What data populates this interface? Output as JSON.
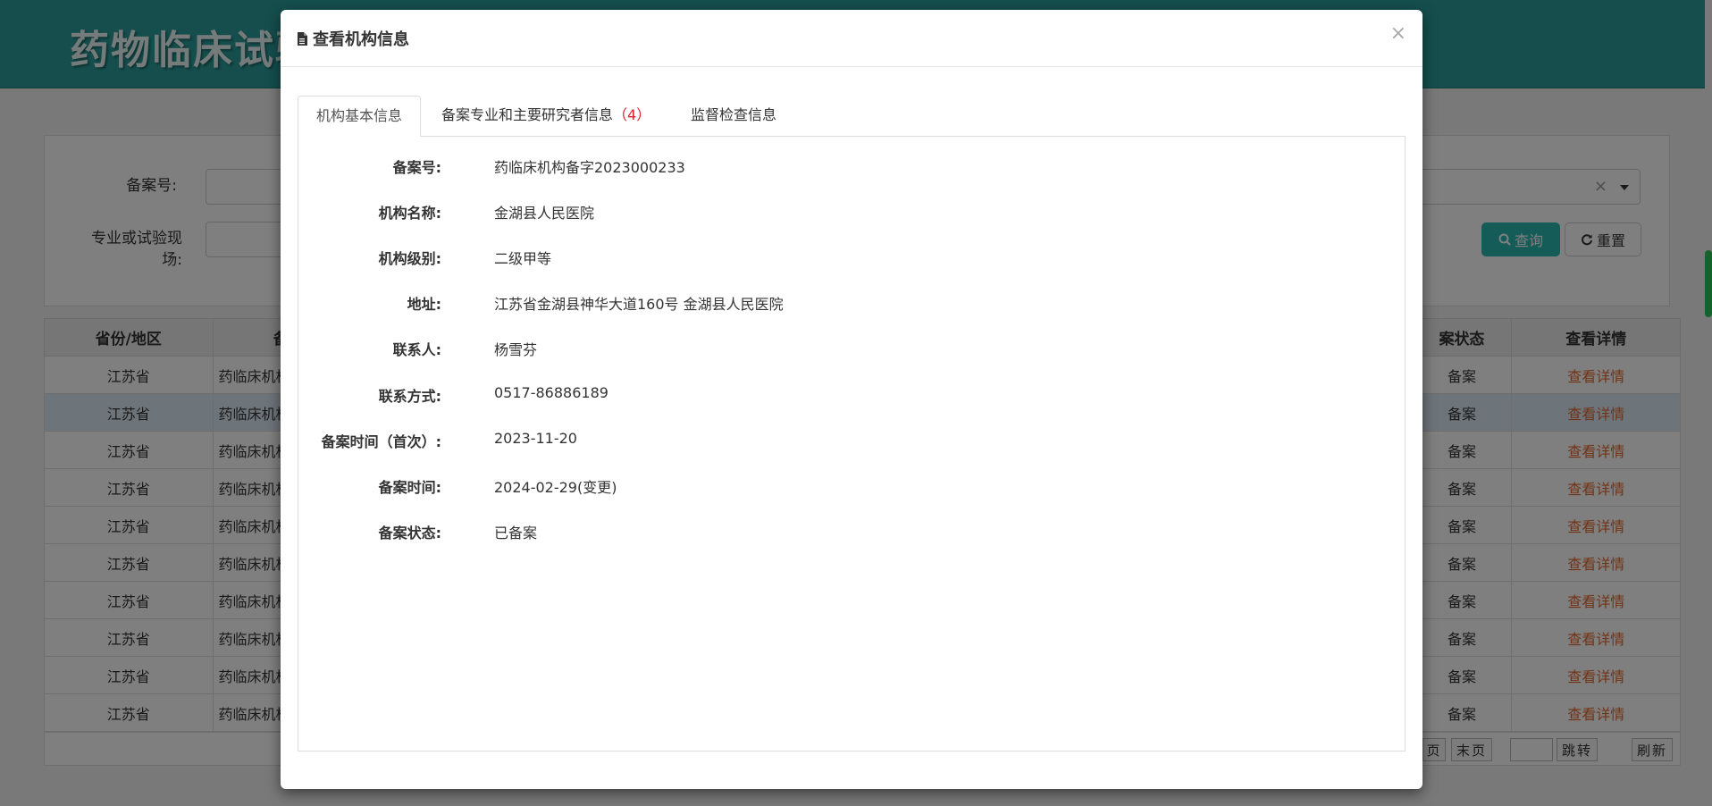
{
  "background": {
    "site_title": "药物临床试验",
    "search": {
      "record_no_label": "备案号:",
      "specialty_label": "专业或试验现场:",
      "query_label": "查询",
      "reset_label": "重置",
      "clear_glyph": "×"
    },
    "table": {
      "headers": [
        "省份/地区",
        "备",
        "案状态",
        "查看详情"
      ],
      "rows": [
        {
          "province": "江苏省",
          "code": "药临床机构",
          "status": "备案",
          "action": "查看详情"
        },
        {
          "province": "江苏省",
          "code": "药临床机构",
          "status": "备案",
          "action": "查看详情"
        },
        {
          "province": "江苏省",
          "code": "药临床机构",
          "status": "备案",
          "action": "查看详情"
        },
        {
          "province": "江苏省",
          "code": "药临床机构",
          "status": "备案",
          "action": "查看详情"
        },
        {
          "province": "江苏省",
          "code": "药临床机构",
          "status": "备案",
          "action": "查看详情"
        },
        {
          "province": "江苏省",
          "code": "药临床机构",
          "status": "备案",
          "action": "查看详情"
        },
        {
          "province": "江苏省",
          "code": "药临床机构",
          "status": "备案",
          "action": "查看详情"
        },
        {
          "province": "江苏省",
          "code": "药临床机构",
          "status": "备案",
          "action": "查看详情"
        },
        {
          "province": "江苏省",
          "code": "药临床机构",
          "status": "备案",
          "action": "查看详情"
        },
        {
          "province": "江苏省",
          "code": "药临床机构",
          "status": "备案",
          "action": "查看详情"
        }
      ]
    },
    "pager": {
      "prev_partial": "页",
      "last": "末页",
      "jump": "跳转",
      "refresh": "刷新"
    }
  },
  "modal": {
    "title": "查看机构信息",
    "close_glyph": "×",
    "tabs": [
      {
        "label": "机构基本信息",
        "count": ""
      },
      {
        "label": "备案专业和主要研究者信息",
        "count": "（4）"
      },
      {
        "label": "监督检查信息",
        "count": ""
      }
    ],
    "fields": [
      {
        "label": "备案号:",
        "value": "药临床机构备字2023000233"
      },
      {
        "label": "机构名称:",
        "value": "金湖县人民医院"
      },
      {
        "label": "机构级别:",
        "value": "二级甲等"
      },
      {
        "label": "地址:",
        "value": "江苏省金湖县神华大道160号 金湖县人民医院"
      },
      {
        "label": "联系人:",
        "value": "杨雪芬"
      },
      {
        "label": "联系方式:",
        "value": "0517-86886189"
      },
      {
        "label": "备案时间（首次）:",
        "value": "2023-11-20"
      },
      {
        "label": "备案时间:",
        "value": "2024-02-29(变更)"
      },
      {
        "label": "备案状态:",
        "value": "已备案"
      }
    ]
  }
}
